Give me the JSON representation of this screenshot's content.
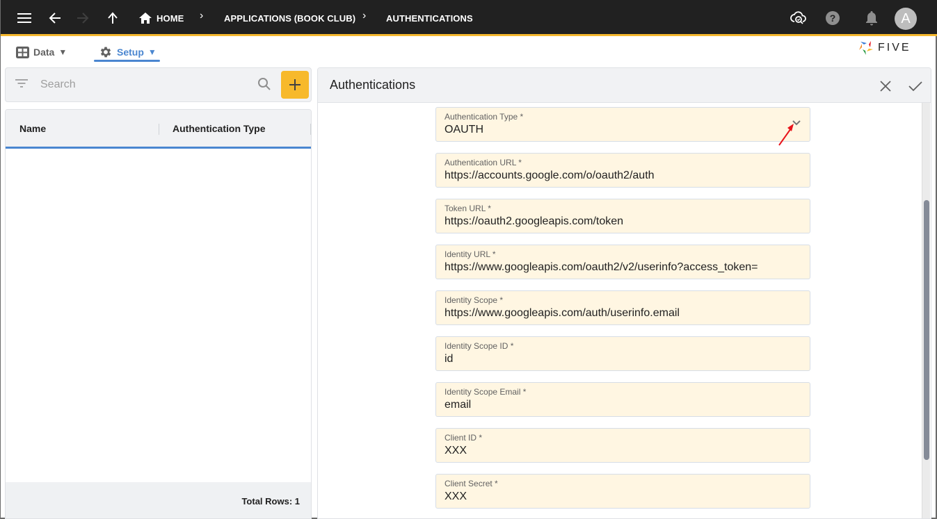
{
  "topbar": {
    "breadcrumbs": [
      {
        "label": "HOME"
      },
      {
        "label": "APPLICATIONS (BOOK CLUB)"
      },
      {
        "label": "AUTHENTICATIONS"
      }
    ],
    "avatar_initial": "A",
    "icons": [
      "menu-icon",
      "back-arrow-icon",
      "forward-arrow-icon",
      "up-arrow-icon",
      "home-icon",
      "cloud-search-icon",
      "help-icon",
      "bell-icon"
    ]
  },
  "menubar": {
    "items": [
      {
        "label": "Data",
        "caret": "▼",
        "icon": "grid-icon",
        "active": false
      },
      {
        "label": "Setup",
        "caret": "▼",
        "icon": "gear-icon",
        "active": true
      }
    ],
    "logo_text": "FIVE"
  },
  "list": {
    "search_placeholder": "Search",
    "search_value": "",
    "columns": [
      "Name",
      "Authentication Type"
    ],
    "rows": [],
    "total_rows_label": "Total Rows: 1"
  },
  "form": {
    "title": "Authentications",
    "fields": [
      {
        "label": "Authentication Type *",
        "value": "OAUTH",
        "type": "select"
      },
      {
        "label": "Authentication URL *",
        "value": "https://accounts.google.com/o/oauth2/auth"
      },
      {
        "label": "Token URL *",
        "value": "https://oauth2.googleapis.com/token"
      },
      {
        "label": "Identity URL *",
        "value": "https://www.googleapis.com/oauth2/v2/userinfo?access_token="
      },
      {
        "label": "Identity Scope *",
        "value": "https://www.googleapis.com/auth/userinfo.email"
      },
      {
        "label": "Identity Scope ID *",
        "value": "id"
      },
      {
        "label": "Identity Scope Email *",
        "value": "email"
      },
      {
        "label": "Client ID *",
        "value": "XXX"
      },
      {
        "label": "Client Secret *",
        "value": "XXX"
      }
    ]
  },
  "colors": {
    "accent_blue": "#4a86d0",
    "accent_yellow": "#f7b92b",
    "topbar_bg": "#212121",
    "field_bg": "#fff6e2",
    "annotation_red": "#e8141b"
  }
}
